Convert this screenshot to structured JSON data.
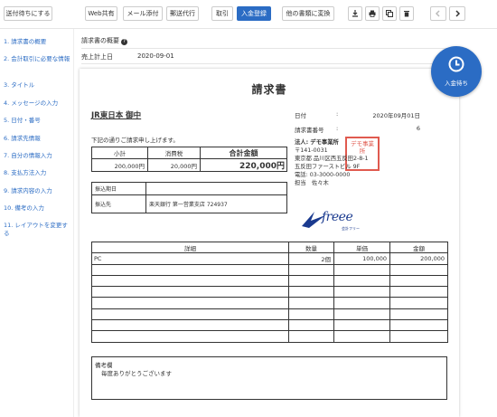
{
  "toolbar": {
    "send_wait": "送付待ちにする",
    "web_share": "Web共有",
    "mail_attach": "メール添付",
    "mail_agency": "郵送代行",
    "cancel": "取引",
    "payment_register": "入金登録",
    "convert": "他の書類に変換",
    "download_icon": "download-icon",
    "print_icon": "print-icon",
    "copy_icon": "copy-icon",
    "delete_icon": "trash-icon",
    "prev_icon": "chevron-left-icon",
    "next_icon": "chevron-right-icon"
  },
  "sidebar": {
    "items": [
      "1. 請求書の概要",
      "2. 会計取引に必要な情報",
      "3. タイトル",
      "4. メッセージの入力",
      "5. 日付・番号",
      "6. 請求先情報",
      "7. 自分の情報入力",
      "8. 支払方法入力",
      "9. 請求内容の入力",
      "10. 備考の入力",
      "11. レイアウトを変更する"
    ]
  },
  "overview": {
    "heading": "請求書の概要",
    "sales_date_label": "売上計上日",
    "sales_date_value": "2020-09-01"
  },
  "invoice": {
    "title": "請求書",
    "recipient": "JR東日本 御中",
    "intro": "下記の通りご請求申し上げます。",
    "subtotal_label": "小計",
    "tax_label": "消費税",
    "total_label": "合計金額",
    "subtotal": "200,000円",
    "tax": "20,000円",
    "total": "220,000円",
    "due_label": "振込期日",
    "due_value": "",
    "bank_label": "振込先",
    "bank_value": "楽天銀行 第一営業支店 724937",
    "date_label": "日付",
    "date_colon": ":",
    "date_value": "2020年09月01日",
    "number_label": "請求書番号",
    "number_colon": ":",
    "number_value": "6",
    "issuer": {
      "name": "法人: デモ事業所",
      "postal": "〒141-0031",
      "address1": "東京都 品川区西五反田2-8-1",
      "address2": "五反田ファーストビル 9F",
      "phone": "電話: 03-3000-0000",
      "person": "担当　佐々木"
    },
    "seal_text": "デモ事業所",
    "logo_text": "freee",
    "logo_sub": "会計フリー",
    "items_headers": [
      "詳細",
      "数量",
      "単価",
      "金額"
    ],
    "items": [
      [
        "PC",
        "2個",
        "100,000",
        "200,000"
      ],
      [
        "",
        "",
        "",
        ""
      ],
      [
        "",
        "",
        "",
        ""
      ],
      [
        "",
        "",
        "",
        ""
      ],
      [
        "",
        "",
        "",
        ""
      ],
      [
        "",
        "",
        "",
        ""
      ],
      [
        "",
        "",
        "",
        ""
      ],
      [
        "",
        "",
        "",
        ""
      ]
    ],
    "remarks_label": "備考欄",
    "remarks_text": "毎度ありがとうございます"
  },
  "fab": {
    "label": "入金待ち",
    "icon": "clock-icon"
  },
  "colors": {
    "accent": "#2b6cc4",
    "seal": "#e05a4f"
  }
}
